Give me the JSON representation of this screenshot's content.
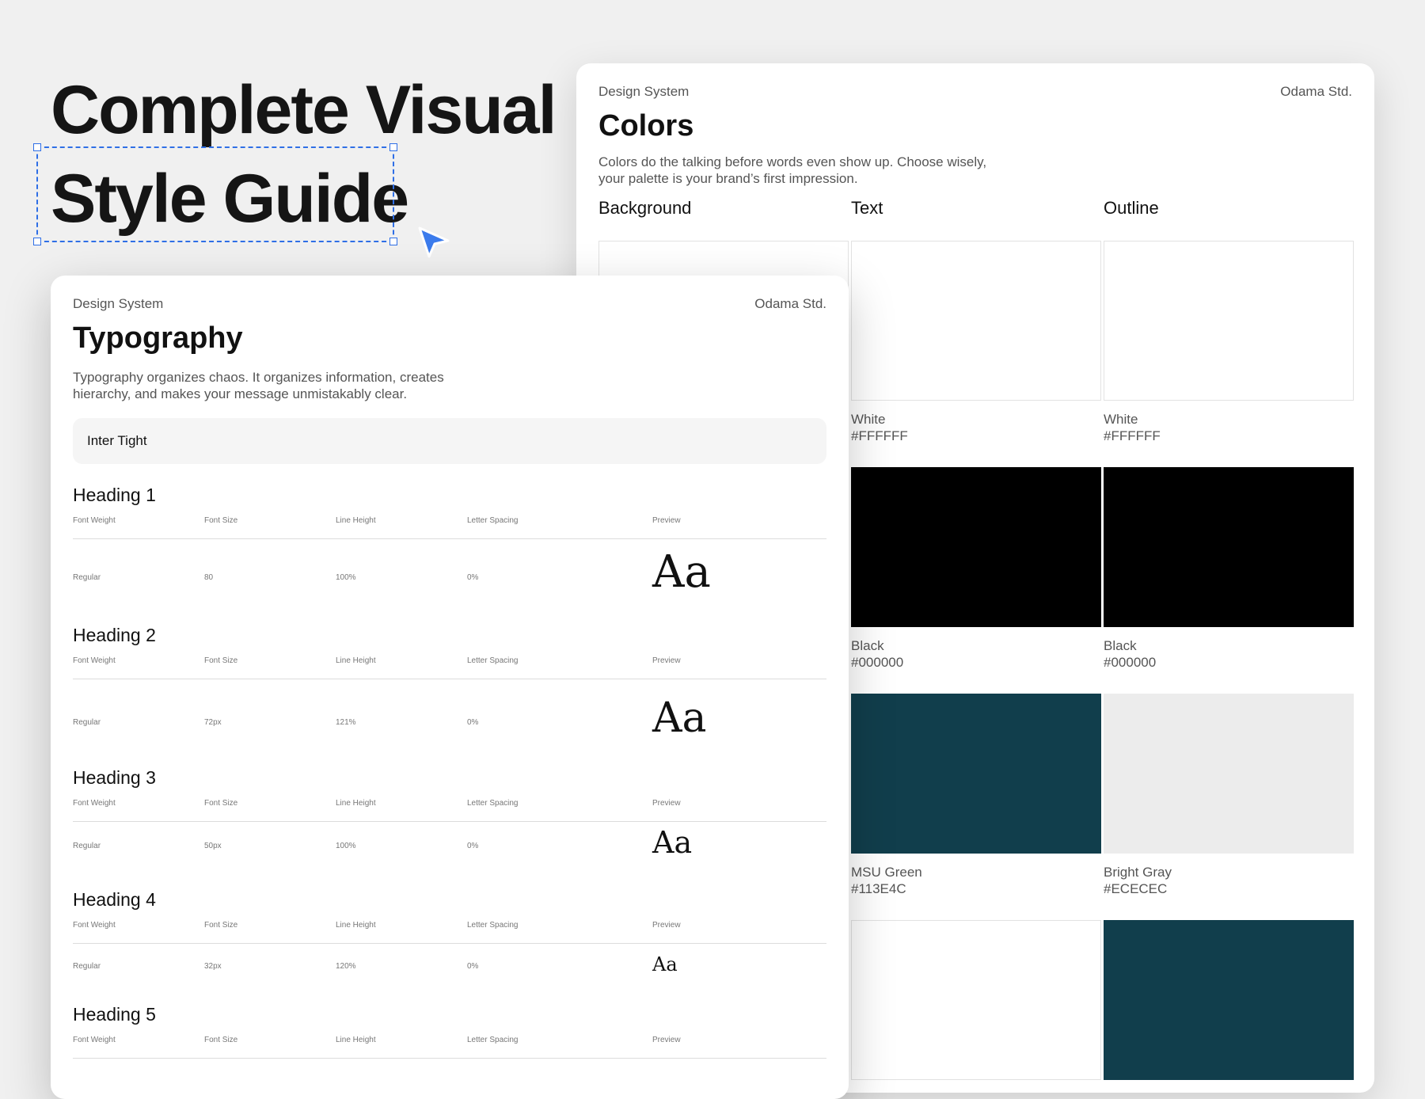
{
  "hero": {
    "line1": "Complete Visual",
    "line2": "Style Guide"
  },
  "colors_card": {
    "label": "Design System",
    "brand": "Odama Std.",
    "title": "Colors",
    "desc": "Colors do the talking before words even show up. Choose wisely, your palette is your brand’s first impression.",
    "columns": [
      {
        "heading": "Background",
        "swatches": [
          {
            "name": "",
            "hex": "",
            "color": "#FFFFFF"
          },
          {
            "name": "",
            "hex": "",
            "color": "#000000"
          },
          {
            "name": "",
            "hex": "",
            "color": "#113E4C"
          },
          {
            "name": "",
            "hex": "",
            "color": "#FFFFFF"
          }
        ]
      },
      {
        "heading": "Text",
        "swatches": [
          {
            "name": "White",
            "hex": "#FFFFFF",
            "color": "#FFFFFF"
          },
          {
            "name": "Black",
            "hex": "#000000",
            "color": "#000000"
          },
          {
            "name": "MSU Green",
            "hex": "#113E4C",
            "color": "#113E4C"
          },
          {
            "name": "",
            "hex": "",
            "color": "#FFFFFF"
          }
        ]
      },
      {
        "heading": "Outline",
        "swatches": [
          {
            "name": "White",
            "hex": "#FFFFFF",
            "color": "#FFFFFF"
          },
          {
            "name": "Black",
            "hex": "#000000",
            "color": "#000000"
          },
          {
            "name": "Bright Gray",
            "hex": "#ECECEC",
            "color": "#ECECEC"
          },
          {
            "name": "",
            "hex": "",
            "color": "#113E4C"
          }
        ]
      }
    ]
  },
  "typography_card": {
    "label": "Design System",
    "brand": "Odama Std.",
    "title": "Typography",
    "desc": "Typography organizes chaos. It organizes information, creates hierarchy, and makes your message unmistakably clear.",
    "font_family": "Inter Tight",
    "meta_labels": [
      "Font Weight",
      "Font Size",
      "Line Height",
      "Letter Spacing",
      "Preview"
    ],
    "headings": [
      {
        "title": "Heading 1",
        "weight": "Regular",
        "size": "80",
        "line_height": "100%",
        "letter_spacing": "0%",
        "preview": "Aa"
      },
      {
        "title": "Heading 2",
        "weight": "Regular",
        "size": "72px",
        "line_height": "121%",
        "letter_spacing": "0%",
        "preview": "Aa"
      },
      {
        "title": "Heading 3",
        "weight": "Regular",
        "size": "50px",
        "line_height": "100%",
        "letter_spacing": "0%",
        "preview": "Aa"
      },
      {
        "title": "Heading 4",
        "weight": "Regular",
        "size": "32px",
        "line_height": "120%",
        "letter_spacing": "0%",
        "preview": "Aa"
      },
      {
        "title": "Heading 5",
        "weight": "",
        "size": "",
        "line_height": "",
        "letter_spacing": "",
        "preview": ""
      }
    ]
  },
  "icons": {
    "cursor": "pointer-cursor-icon"
  }
}
